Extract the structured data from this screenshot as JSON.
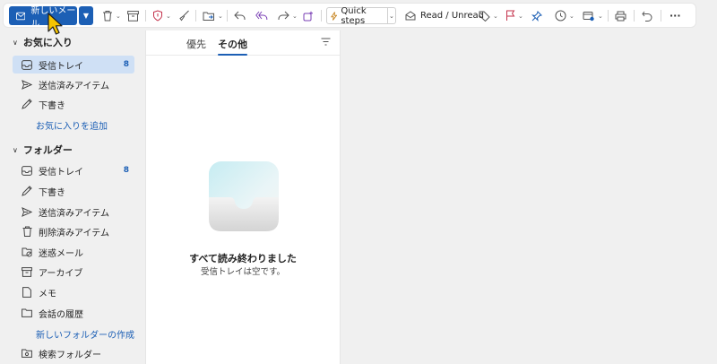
{
  "ribbon": {
    "new_mail_label": "新しいメール",
    "quick_steps_label": "Quick steps",
    "read_unread_label": "Read / Unread",
    "more_label": "···"
  },
  "colors": {
    "accent": "#1c5fb5",
    "selected": "#cfe0f5",
    "flag": "#c4314b"
  },
  "sidebar": {
    "favorites_header": "お気に入り",
    "favorites": [
      {
        "label": "受信トレイ",
        "count": "8",
        "icon": "inbox-icon",
        "selected": true
      },
      {
        "label": "送信済みアイテム",
        "count": "",
        "icon": "send-icon"
      },
      {
        "label": "下書き",
        "count": "",
        "icon": "draft-icon"
      }
    ],
    "add_favorite_link": "お気に入りを追加",
    "folders_header": "フォルダー",
    "folders": [
      {
        "label": "受信トレイ",
        "count": "8",
        "icon": "inbox-icon"
      },
      {
        "label": "下書き",
        "count": "",
        "icon": "draft-icon"
      },
      {
        "label": "送信済みアイテム",
        "count": "",
        "icon": "send-icon"
      },
      {
        "label": "削除済みアイテム",
        "count": "",
        "icon": "trash-icon"
      },
      {
        "label": "迷惑メール",
        "count": "",
        "icon": "junk-icon"
      },
      {
        "label": "アーカイブ",
        "count": "",
        "icon": "archive-icon"
      },
      {
        "label": "メモ",
        "count": "",
        "icon": "note-icon"
      },
      {
        "label": "会話の履歴",
        "count": "",
        "icon": "folder-icon"
      }
    ],
    "new_folder_link": "新しいフォルダーの作成",
    "search_folder_label": "検索フォルダー"
  },
  "list": {
    "tabs": [
      {
        "label": "優先",
        "active": false
      },
      {
        "label": "その他",
        "active": true
      }
    ],
    "empty_title": "すべて読み終わりました",
    "empty_subtitle": "受信トレイは空です。"
  }
}
